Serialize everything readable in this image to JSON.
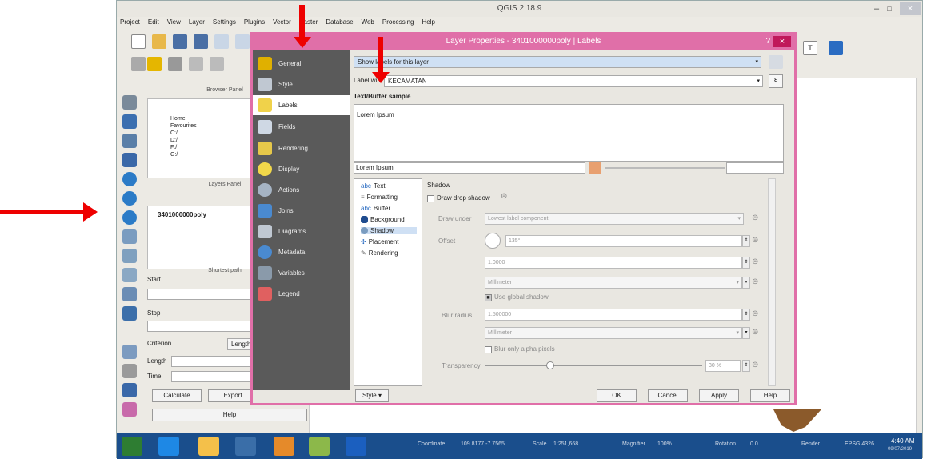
{
  "window": {
    "title": "QGIS 2.18.9",
    "min": "–",
    "max": "□",
    "close": "×"
  },
  "menu": [
    "Project",
    "Edit",
    "View",
    "Layer",
    "Settings",
    "Plugins",
    "Vector",
    "Raster",
    "Database",
    "Web",
    "Processing",
    "Help"
  ],
  "browser": {
    "title": "Browser Panel",
    "items": [
      "Home",
      "Favourites",
      "C:/",
      "D:/",
      "F:/",
      "G:/"
    ]
  },
  "layers": {
    "title": "Layers Panel",
    "layer_name": "3401000000poly"
  },
  "shortest": {
    "title": "Shortest path",
    "start": "Start",
    "stop": "Stop",
    "criterion": "Criterion",
    "criterion_value": "Length",
    "length": "Length",
    "time": "Time",
    "calculate": "Calculate",
    "export": "Export",
    "help": "Help"
  },
  "dialog": {
    "title": "Layer Properties - 3401000000poly | Labels",
    "help_q": "?",
    "close": "×",
    "nav": [
      "General",
      "Style",
      "Labels",
      "Fields",
      "Rendering",
      "Display",
      "Actions",
      "Joins",
      "Diagrams",
      "Metadata",
      "Variables",
      "Legend"
    ],
    "mode_select": "Show labels for this layer",
    "label_with": "Label with",
    "label_field": "KECAMATAN",
    "sample_title": "Text/Buffer sample",
    "sample_text": "Lorem Ipsum",
    "sample_input": "Lorem Ipsum",
    "sub_nav": [
      "Text",
      "Formatting",
      "Buffer",
      "Background",
      "Shadow",
      "Placement",
      "Rendering"
    ],
    "shadow": {
      "heading": "Shadow",
      "draw": "Draw drop shadow",
      "draw_under": "Draw under",
      "draw_under_value": "Lowest label component",
      "offset": "Offset",
      "offset_angle": "135°",
      "offset_value": "1.0000",
      "offset_unit": "Millimeter",
      "use_global": "Use global shadow",
      "blur_radius": "Blur radius",
      "blur_value": "1.500000",
      "blur_unit": "Millimeter",
      "blur_alpha": "Blur only alpha pixels",
      "transparency": "Transparency",
      "transparency_value": "30 %",
      "transparency_level": 0.3
    },
    "style_btn": "Style",
    "ok": "OK",
    "cancel": "Cancel",
    "apply": "Apply",
    "help": "Help"
  },
  "status": {
    "coordinate_label": "Coordinate",
    "coordinate": "109.8177,-7.7565",
    "scale_label": "Scale",
    "scale": "1:251,668",
    "magnifier_label": "Magnifier",
    "magnifier": "100%",
    "rotation_label": "Rotation",
    "rotation": "0.0",
    "render": "Render",
    "epsg": "EPSG:4326",
    "time": "4:40 AM",
    "date": "09/07/2019"
  }
}
